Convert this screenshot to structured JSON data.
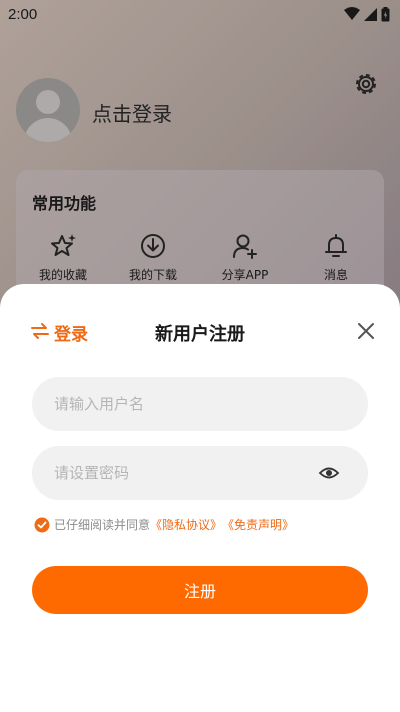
{
  "status_bar": {
    "time": "2:00"
  },
  "profile": {
    "login_prompt": "点击登录"
  },
  "common_functions": {
    "title": "常用功能",
    "items": [
      {
        "label": "我的收藏",
        "icon": "star-sparkle-icon"
      },
      {
        "label": "我的下载",
        "icon": "download-circle-icon"
      },
      {
        "label": "分享APP",
        "icon": "user-add-icon"
      },
      {
        "label": "消息",
        "icon": "bell-icon"
      }
    ]
  },
  "register_sheet": {
    "switch_tab_label": "登录",
    "title": "新用户注册",
    "username_placeholder": "请输入用户名",
    "password_placeholder": "请设置密码",
    "agreement_prefix": "已仔细阅读并同意",
    "privacy_link": "《隐私协议》",
    "disclaimer_link": "《免责声明》",
    "submit_label": "注册"
  },
  "colors": {
    "accent": "#ff6a00",
    "link": "#f06a15"
  }
}
